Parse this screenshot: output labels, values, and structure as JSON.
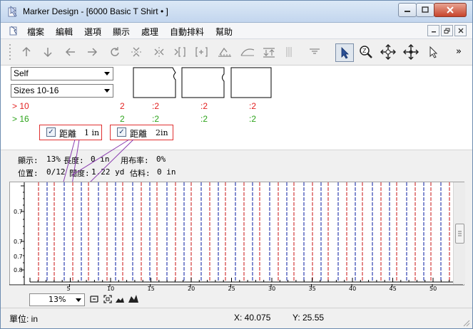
{
  "window": {
    "title": "Marker Design - [6000 Basic T Shirt • ]",
    "buttons": [
      "minimize",
      "maximize",
      "close"
    ]
  },
  "menu": {
    "items": [
      "檔案",
      "編輯",
      "選項",
      "顯示",
      "處理",
      "自動排料",
      "幫助"
    ]
  },
  "toolbar": {
    "icons": [
      "arrow-up-icon",
      "arrow-down-icon",
      "arrow-left-icon",
      "arrow-right-icon",
      "rotate-icon",
      "flip-vertical-icon",
      "flip-horizontal-icon",
      "bracket-right-icon",
      "bracket-left-icon",
      "ruler-angle-icon",
      "ruler-curve-icon",
      "align-bottom-icon",
      "divider-icon",
      "menu-lines-icon",
      "pointer-select-icon",
      "zoom-icon",
      "move-icon",
      "move-cross-icon",
      "cursor-icon",
      "more-icon"
    ],
    "more_label": "»"
  },
  "panel": {
    "fabric_select": "Self",
    "size_select": "Sizes 10-16",
    "size_rows": [
      {
        "marker": ">",
        "size": "10",
        "total": "2",
        "counts": [
          ":2",
          ":2",
          ":2"
        ],
        "color": "#e21f1f"
      },
      {
        "marker": ">",
        "size": "16",
        "total": "2",
        "counts": [
          ":2",
          ":2",
          ":2"
        ],
        "color": "#2ca41a"
      }
    ],
    "distance": [
      {
        "label": "距離",
        "value": "1 in",
        "checked": "✓"
      },
      {
        "label": "距離",
        "value": "2in",
        "checked": "✓"
      }
    ]
  },
  "status": {
    "display_label": "顯示:",
    "display_value": "13%",
    "length_label": "長度:",
    "length_value": "0 in",
    "usage_label": "用布率:",
    "usage_value": "0%",
    "position_label": "位置:",
    "position_value": "0/12",
    "width_label": "闊度:",
    "width_value": "1.22 yd",
    "estimate_label": "估料:",
    "estimate_value": "0 in"
  },
  "ruler": {
    "vertical_labels": [
      "0.7",
      "0.7",
      "0.7",
      "0.8"
    ],
    "horizontal_labels": [
      "5",
      "10",
      "15",
      "20",
      "25",
      "30",
      "35",
      "40",
      "45",
      "50"
    ]
  },
  "bottom": {
    "zoom": "13%"
  },
  "statusbar": {
    "unit": "單位: in",
    "x": "X: 40.075",
    "y": "Y: 25.55"
  },
  "colors": {
    "red_line": "#d23a3a",
    "blue_line": "#2e3fb0",
    "accent_red": "#e21f1f",
    "accent_green": "#2ca41a"
  }
}
